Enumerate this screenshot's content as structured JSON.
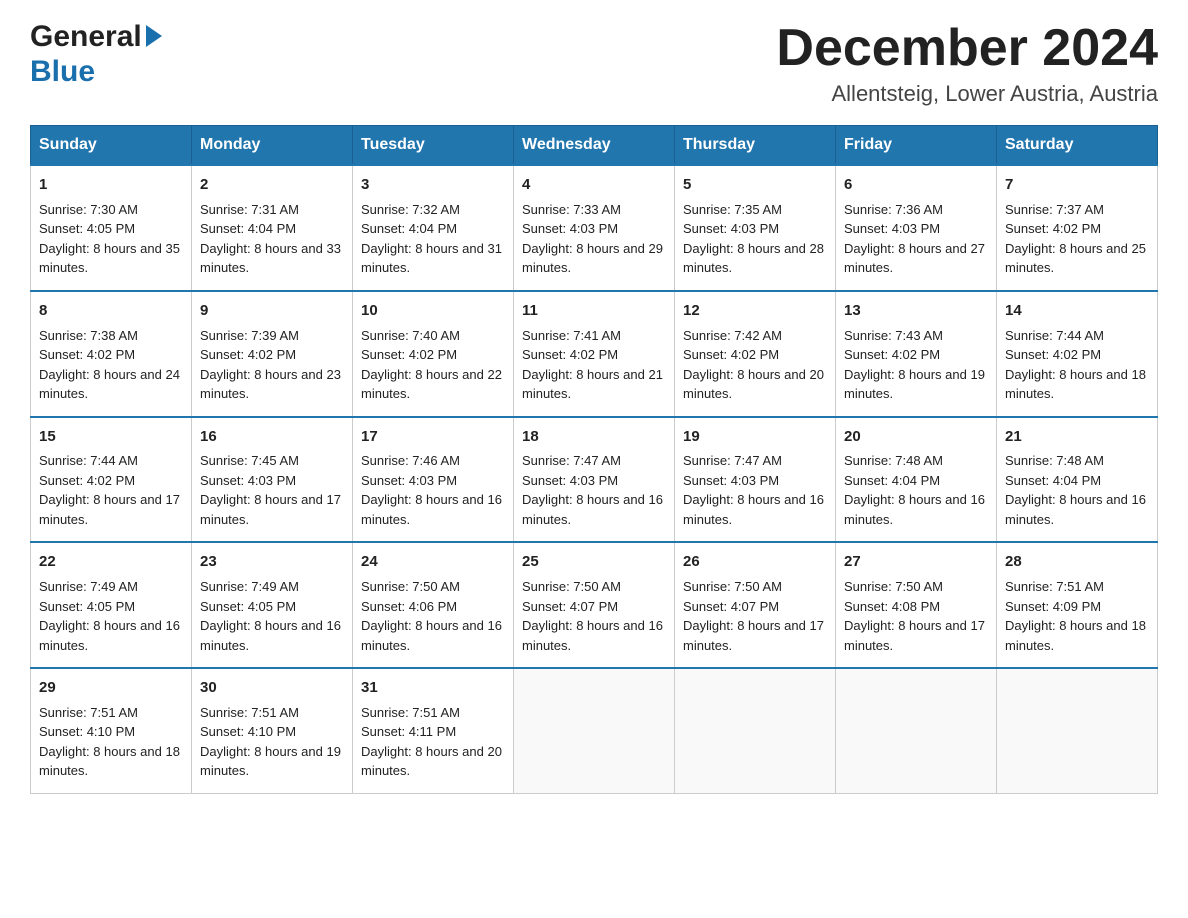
{
  "logo": {
    "line1": "General",
    "line2": "Blue"
  },
  "title": "December 2024",
  "subtitle": "Allentsteig, Lower Austria, Austria",
  "days_of_week": [
    "Sunday",
    "Monday",
    "Tuesday",
    "Wednesday",
    "Thursday",
    "Friday",
    "Saturday"
  ],
  "weeks": [
    [
      {
        "day": "1",
        "sunrise": "7:30 AM",
        "sunset": "4:05 PM",
        "daylight": "8 hours and 35 minutes."
      },
      {
        "day": "2",
        "sunrise": "7:31 AM",
        "sunset": "4:04 PM",
        "daylight": "8 hours and 33 minutes."
      },
      {
        "day": "3",
        "sunrise": "7:32 AM",
        "sunset": "4:04 PM",
        "daylight": "8 hours and 31 minutes."
      },
      {
        "day": "4",
        "sunrise": "7:33 AM",
        "sunset": "4:03 PM",
        "daylight": "8 hours and 29 minutes."
      },
      {
        "day": "5",
        "sunrise": "7:35 AM",
        "sunset": "4:03 PM",
        "daylight": "8 hours and 28 minutes."
      },
      {
        "day": "6",
        "sunrise": "7:36 AM",
        "sunset": "4:03 PM",
        "daylight": "8 hours and 27 minutes."
      },
      {
        "day": "7",
        "sunrise": "7:37 AM",
        "sunset": "4:02 PM",
        "daylight": "8 hours and 25 minutes."
      }
    ],
    [
      {
        "day": "8",
        "sunrise": "7:38 AM",
        "sunset": "4:02 PM",
        "daylight": "8 hours and 24 minutes."
      },
      {
        "day": "9",
        "sunrise": "7:39 AM",
        "sunset": "4:02 PM",
        "daylight": "8 hours and 23 minutes."
      },
      {
        "day": "10",
        "sunrise": "7:40 AM",
        "sunset": "4:02 PM",
        "daylight": "8 hours and 22 minutes."
      },
      {
        "day": "11",
        "sunrise": "7:41 AM",
        "sunset": "4:02 PM",
        "daylight": "8 hours and 21 minutes."
      },
      {
        "day": "12",
        "sunrise": "7:42 AM",
        "sunset": "4:02 PM",
        "daylight": "8 hours and 20 minutes."
      },
      {
        "day": "13",
        "sunrise": "7:43 AM",
        "sunset": "4:02 PM",
        "daylight": "8 hours and 19 minutes."
      },
      {
        "day": "14",
        "sunrise": "7:44 AM",
        "sunset": "4:02 PM",
        "daylight": "8 hours and 18 minutes."
      }
    ],
    [
      {
        "day": "15",
        "sunrise": "7:44 AM",
        "sunset": "4:02 PM",
        "daylight": "8 hours and 17 minutes."
      },
      {
        "day": "16",
        "sunrise": "7:45 AM",
        "sunset": "4:03 PM",
        "daylight": "8 hours and 17 minutes."
      },
      {
        "day": "17",
        "sunrise": "7:46 AM",
        "sunset": "4:03 PM",
        "daylight": "8 hours and 16 minutes."
      },
      {
        "day": "18",
        "sunrise": "7:47 AM",
        "sunset": "4:03 PM",
        "daylight": "8 hours and 16 minutes."
      },
      {
        "day": "19",
        "sunrise": "7:47 AM",
        "sunset": "4:03 PM",
        "daylight": "8 hours and 16 minutes."
      },
      {
        "day": "20",
        "sunrise": "7:48 AM",
        "sunset": "4:04 PM",
        "daylight": "8 hours and 16 minutes."
      },
      {
        "day": "21",
        "sunrise": "7:48 AM",
        "sunset": "4:04 PM",
        "daylight": "8 hours and 16 minutes."
      }
    ],
    [
      {
        "day": "22",
        "sunrise": "7:49 AM",
        "sunset": "4:05 PM",
        "daylight": "8 hours and 16 minutes."
      },
      {
        "day": "23",
        "sunrise": "7:49 AM",
        "sunset": "4:05 PM",
        "daylight": "8 hours and 16 minutes."
      },
      {
        "day": "24",
        "sunrise": "7:50 AM",
        "sunset": "4:06 PM",
        "daylight": "8 hours and 16 minutes."
      },
      {
        "day": "25",
        "sunrise": "7:50 AM",
        "sunset": "4:07 PM",
        "daylight": "8 hours and 16 minutes."
      },
      {
        "day": "26",
        "sunrise": "7:50 AM",
        "sunset": "4:07 PM",
        "daylight": "8 hours and 17 minutes."
      },
      {
        "day": "27",
        "sunrise": "7:50 AM",
        "sunset": "4:08 PM",
        "daylight": "8 hours and 17 minutes."
      },
      {
        "day": "28",
        "sunrise": "7:51 AM",
        "sunset": "4:09 PM",
        "daylight": "8 hours and 18 minutes."
      }
    ],
    [
      {
        "day": "29",
        "sunrise": "7:51 AM",
        "sunset": "4:10 PM",
        "daylight": "8 hours and 18 minutes."
      },
      {
        "day": "30",
        "sunrise": "7:51 AM",
        "sunset": "4:10 PM",
        "daylight": "8 hours and 19 minutes."
      },
      {
        "day": "31",
        "sunrise": "7:51 AM",
        "sunset": "4:11 PM",
        "daylight": "8 hours and 20 minutes."
      },
      null,
      null,
      null,
      null
    ]
  ],
  "labels": {
    "sunrise": "Sunrise: ",
    "sunset": "Sunset: ",
    "daylight": "Daylight: "
  }
}
